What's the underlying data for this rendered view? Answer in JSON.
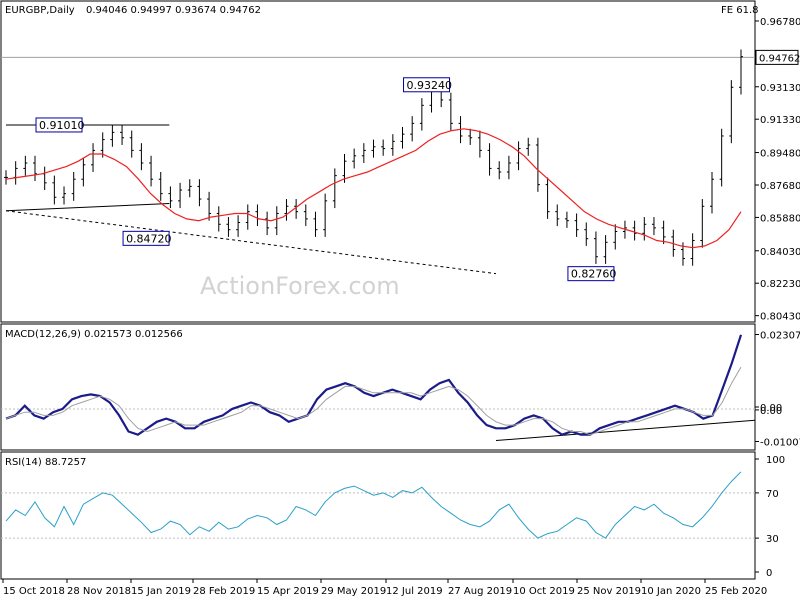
{
  "chart_data": [
    {
      "type": "candlestick",
      "title": "EURGBP,Daily",
      "ohlc_label": "0.94046 0.94997 0.93674 0.94762",
      "fe_label": "FE 61.8",
      "last_price": "0.94762",
      "ylim": [
        0.803,
        0.975
      ],
      "y_ticks": [
        "0.96780",
        "0.93130",
        "0.91330",
        "0.89480",
        "0.87680",
        "0.85880",
        "0.84030",
        "0.82230",
        "0.80430"
      ],
      "x_ticks": [
        "15 Oct 2018",
        "28 Nov 2018",
        "15 Jan 2019",
        "28 Feb 2019",
        "15 Apr 2019",
        "29 May 2019",
        "12 Jul 2019",
        "27 Aug 2019",
        "10 Oct 2019",
        "25 Nov 2019",
        "10 Jan 2020",
        "25 Feb 2020"
      ],
      "annotations": [
        "0.91010",
        "0.93240",
        "0.84720",
        "0.82760"
      ],
      "price_series": [
        0.881,
        0.886,
        0.889,
        0.883,
        0.878,
        0.87,
        0.872,
        0.88,
        0.888,
        0.896,
        0.902,
        0.906,
        0.903,
        0.896,
        0.889,
        0.88,
        0.872,
        0.868,
        0.874,
        0.876,
        0.869,
        0.861,
        0.855,
        0.852,
        0.856,
        0.862,
        0.858,
        0.853,
        0.861,
        0.865,
        0.862,
        0.858,
        0.852,
        0.868,
        0.882,
        0.89,
        0.893,
        0.896,
        0.898,
        0.897,
        0.901,
        0.905,
        0.911,
        0.921,
        0.932,
        0.924,
        0.911,
        0.904,
        0.903,
        0.896,
        0.886,
        0.884,
        0.889,
        0.897,
        0.899,
        0.877,
        0.862,
        0.858,
        0.857,
        0.852,
        0.847,
        0.837,
        0.845,
        0.851,
        0.853,
        0.85,
        0.855,
        0.853,
        0.848,
        0.841,
        0.836,
        0.846,
        0.865,
        0.88,
        0.904,
        0.931,
        0.948
      ],
      "ma_series": [
        0.88,
        0.881,
        0.882,
        0.883,
        0.885,
        0.887,
        0.89,
        0.894,
        0.894,
        0.891,
        0.887,
        0.88,
        0.872,
        0.866,
        0.861,
        0.858,
        0.857,
        0.859,
        0.86,
        0.861,
        0.861,
        0.858,
        0.857,
        0.859,
        0.864,
        0.869,
        0.873,
        0.877,
        0.88,
        0.882,
        0.884,
        0.887,
        0.89,
        0.893,
        0.896,
        0.901,
        0.905,
        0.907,
        0.908,
        0.907,
        0.905,
        0.902,
        0.898,
        0.893,
        0.886,
        0.88,
        0.874,
        0.868,
        0.862,
        0.858,
        0.855,
        0.853,
        0.851,
        0.849,
        0.846,
        0.845,
        0.843,
        0.842,
        0.843,
        0.846,
        0.852,
        0.862
      ],
      "trendlines": [
        {
          "style": "solid",
          "from": [
            0,
            0.9101
          ],
          "to": [
            40,
            0.9101
          ]
        },
        {
          "style": "solid",
          "from": [
            0,
            0.8625
          ],
          "to": [
            40,
            0.8665
          ]
        },
        {
          "style": "dashed",
          "from": [
            0,
            0.8625
          ],
          "to": [
            120,
            0.8276
          ]
        }
      ]
    },
    {
      "type": "line",
      "title": "MACD(12,26,9) 0.021573 0.012566",
      "y_ticks": [
        "0.023079",
        "0.00",
        "0.00",
        "-0.010072"
      ],
      "ylim": [
        -0.0115,
        0.0245
      ],
      "series": [
        {
          "values": [
            -0.003,
            -0.002,
            0.001,
            -0.002,
            -0.003,
            -0.001,
            0.0,
            0.003,
            0.004,
            0.0045,
            0.004,
            0.002,
            -0.002,
            -0.007,
            -0.008,
            -0.006,
            -0.004,
            -0.003,
            -0.004,
            -0.006,
            -0.006,
            -0.004,
            -0.003,
            -0.002,
            0.0,
            0.001,
            0.002,
            0.001,
            -0.001,
            -0.002,
            -0.004,
            -0.003,
            -0.002,
            0.003,
            0.006,
            0.007,
            0.008,
            0.007,
            0.005,
            0.004,
            0.005,
            0.006,
            0.005,
            0.004,
            0.003,
            0.006,
            0.008,
            0.009,
            0.005,
            0.002,
            -0.002,
            -0.005,
            -0.006,
            -0.006,
            -0.005,
            -0.003,
            -0.002,
            -0.003,
            -0.006,
            -0.008,
            -0.007,
            -0.008,
            -0.008,
            -0.006,
            -0.005,
            -0.004,
            -0.004,
            -0.003,
            -0.002,
            -0.001,
            0.0,
            0.001,
            0.0,
            -0.001,
            -0.003,
            -0.002,
            0.006,
            0.014,
            0.023
          ]
        },
        {
          "values": [
            -0.003,
            -0.002,
            -0.001,
            -0.001,
            -0.002,
            -0.002,
            -0.001,
            0.001,
            0.002,
            0.003,
            0.004,
            0.003,
            0.001,
            -0.003,
            -0.006,
            -0.007,
            -0.006,
            -0.005,
            -0.004,
            -0.005,
            -0.005,
            -0.005,
            -0.004,
            -0.003,
            -0.002,
            -0.001,
            0.001,
            0.001,
            0.0,
            -0.001,
            -0.002,
            -0.003,
            -0.002,
            0.0,
            0.003,
            0.005,
            0.007,
            0.007,
            0.006,
            0.005,
            0.005,
            0.005,
            0.005,
            0.005,
            0.004,
            0.005,
            0.006,
            0.007,
            0.006,
            0.004,
            0.001,
            -0.002,
            -0.004,
            -0.005,
            -0.005,
            -0.004,
            -0.003,
            -0.003,
            -0.004,
            -0.006,
            -0.007,
            -0.007,
            -0.008,
            -0.007,
            -0.006,
            -0.005,
            -0.004,
            -0.004,
            -0.003,
            -0.002,
            -0.001,
            0.0,
            0.0,
            -0.001,
            -0.002,
            -0.002,
            0.002,
            0.008,
            0.013
          ]
        }
      ],
      "trendline": {
        "from": [
          120,
          -0.0098
        ],
        "to": [
          180,
          -0.0035
        ]
      }
    },
    {
      "type": "line",
      "title": "RSI(14) 88.7257",
      "y_ticks": [
        "100",
        "70",
        "30",
        "0"
      ],
      "ylim": [
        0,
        100
      ],
      "levels": [
        70,
        30
      ],
      "series": [
        {
          "values": [
            45,
            55,
            50,
            62,
            48,
            40,
            58,
            42,
            60,
            65,
            70,
            68,
            60,
            52,
            44,
            35,
            38,
            45,
            42,
            33,
            40,
            36,
            44,
            38,
            40,
            47,
            50,
            48,
            42,
            46,
            58,
            55,
            50,
            62,
            70,
            74,
            76,
            72,
            68,
            70,
            66,
            72,
            70,
            75,
            66,
            58,
            52,
            46,
            42,
            40,
            45,
            55,
            60,
            48,
            38,
            30,
            34,
            36,
            42,
            48,
            45,
            35,
            30,
            42,
            50,
            58,
            55,
            60,
            52,
            48,
            42,
            40,
            48,
            58,
            70,
            80,
            88.7
          ]
        }
      ]
    }
  ],
  "watermark": "ActionForex.com",
  "colors": {
    "price": "#000000",
    "ma": "#ee2222",
    "macd": "#1b1b8a",
    "signal": "#a0a0a0",
    "rsi": "#2aa0c8",
    "annotation_border": "#0000a0"
  }
}
